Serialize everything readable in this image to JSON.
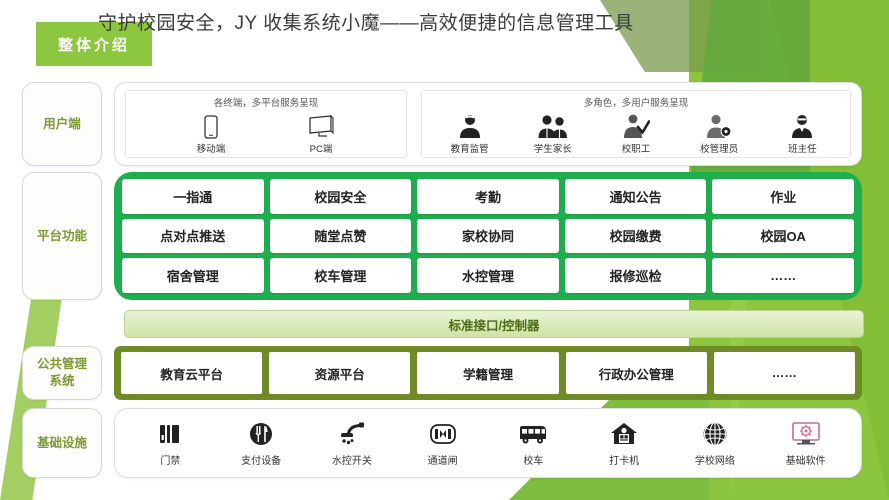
{
  "header": {
    "badge_label": "整体介绍",
    "title": "守护校园安全，JY 收集系统小魔——高效便捷的信息管理工具"
  },
  "colors": {
    "brand_green": "#8dc63f",
    "platform_green": "#1fae4d",
    "public_olive": "#6e8b25",
    "label_text": "#7d9a33",
    "interface_text": "#4c6b16"
  },
  "rows": {
    "user": {
      "label": "用户端",
      "panels": [
        {
          "caption": "各终端，多平台服务呈现",
          "items": [
            {
              "icon": "mobile-phone-icon",
              "label": "移动端"
            },
            {
              "icon": "desktop-monitor-icon",
              "label": "PC端"
            }
          ]
        },
        {
          "caption": "多角色，多用户服务呈现",
          "items": [
            {
              "icon": "person-supervisor-icon",
              "label": "教育监管"
            },
            {
              "icon": "person-parents-icon",
              "label": "学生家长"
            },
            {
              "icon": "person-staff-icon",
              "label": "校职工"
            },
            {
              "icon": "person-admin-icon",
              "label": "校管理员"
            },
            {
              "icon": "person-teacher-icon",
              "label": "班主任"
            }
          ]
        }
      ]
    },
    "platform": {
      "label": "平台功能",
      "functions": [
        "一指通",
        "校园安全",
        "考勤",
        "通知公告",
        "作业",
        "点对点推送",
        "随堂点赞",
        "家校协同",
        "校园缴费",
        "校园OA",
        "宿舍管理",
        "校车管理",
        "水控管理",
        "报修巡检",
        "……"
      ]
    },
    "interface": {
      "label": "标准接口/控制器"
    },
    "public": {
      "label": "公共管理\n系统",
      "label_line1": "公共管理",
      "label_line2": "系统",
      "items": [
        "教育云平台",
        "资源平台",
        "学籍管理",
        "行政办公管理",
        "……"
      ]
    },
    "infrastructure": {
      "label": "基础设施",
      "items": [
        {
          "icon": "access-card-icon",
          "label": "门禁"
        },
        {
          "icon": "payment-device-icon",
          "label": "支付设备"
        },
        {
          "icon": "water-switch-icon",
          "label": "水控开关"
        },
        {
          "icon": "gate-turnstile-icon",
          "label": "通道闸"
        },
        {
          "icon": "school-bus-icon",
          "label": "校车"
        },
        {
          "icon": "punch-clock-icon",
          "label": "打卡机"
        },
        {
          "icon": "globe-network-icon",
          "label": "学校网络"
        },
        {
          "icon": "basic-software-icon",
          "label": "基础软件"
        }
      ]
    }
  }
}
